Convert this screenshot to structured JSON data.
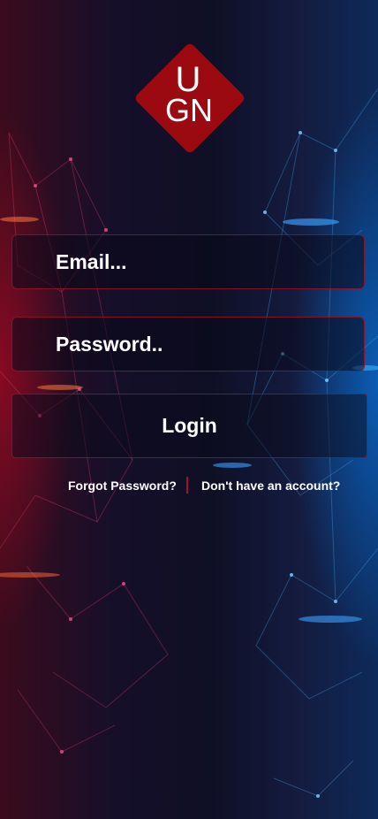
{
  "logo": {
    "text_top": "U",
    "text_bottom": "GN",
    "color": "#9b0a10"
  },
  "form": {
    "email_placeholder": "Email...",
    "password_placeholder": "Password..",
    "login_label": "Login"
  },
  "links": {
    "forgot_password": "Forgot Password?",
    "register": "Don't have an account?"
  },
  "colors": {
    "accent": "#a31228",
    "background": "#120f24",
    "glow_left": "#c80a28",
    "glow_right": "#0a78e6"
  }
}
